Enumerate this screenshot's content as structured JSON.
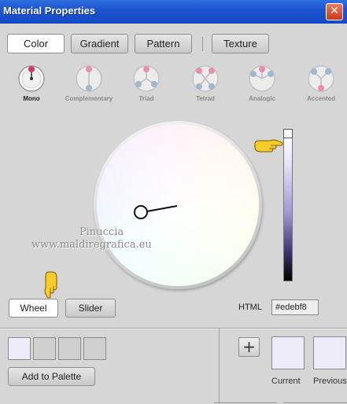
{
  "window": {
    "title": "Material Properties",
    "close_icon": "close-icon"
  },
  "tabs": [
    {
      "label": "Color",
      "active": true
    },
    {
      "label": "Gradient",
      "active": false
    },
    {
      "label": "Pattern",
      "active": false
    },
    {
      "label": "Texture",
      "active": false
    }
  ],
  "harmonies": [
    {
      "label": "Mono",
      "active": true
    },
    {
      "label": "Complementary",
      "active": false
    },
    {
      "label": "Triad",
      "active": false
    },
    {
      "label": "Tetrad",
      "active": false
    },
    {
      "label": "Analogic",
      "active": false
    },
    {
      "label": "Accented",
      "active": false
    }
  ],
  "watermark": {
    "line1": "Pinuccia",
    "line2": "www.maldiregrafica.eu"
  },
  "mode_buttons": {
    "wheel": "Wheel",
    "slider": "Slider",
    "active": "wheel"
  },
  "html_field": {
    "label": "HTML",
    "value": "#edebf8"
  },
  "palette": {
    "add_label": "Add to Palette",
    "slots_filled": 1,
    "slots_total": 4
  },
  "preview": {
    "current_label": "Current",
    "previous_label": "Previous",
    "add_icon": "plus-icon"
  },
  "colors": {
    "selected": "#edebf8",
    "accent": "#d6336c",
    "title_bar": "#1d55d1"
  }
}
